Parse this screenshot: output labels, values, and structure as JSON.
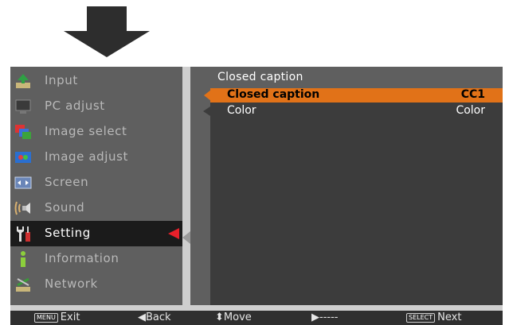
{
  "menu": {
    "items": [
      {
        "label": "Input",
        "icon": "input-icon"
      },
      {
        "label": "PC adjust",
        "icon": "pc-adjust-icon"
      },
      {
        "label": "Image select",
        "icon": "image-select-icon"
      },
      {
        "label": "Image adjust",
        "icon": "image-adjust-icon"
      },
      {
        "label": "Screen",
        "icon": "screen-icon"
      },
      {
        "label": "Sound",
        "icon": "sound-icon"
      },
      {
        "label": "Setting",
        "icon": "setting-icon",
        "selected": true
      },
      {
        "label": "Information",
        "icon": "information-icon"
      },
      {
        "label": "Network",
        "icon": "network-icon"
      }
    ]
  },
  "submenu": {
    "title": "Closed caption",
    "rows": [
      {
        "label": "Closed caption",
        "value": "CC1",
        "active": true
      },
      {
        "label": "Color",
        "value": "Color",
        "active": false
      }
    ]
  },
  "guide": {
    "exit_key": "MENU",
    "exit": "Exit",
    "back": "◀Back",
    "move": "⬍Move",
    "right": "▶-----",
    "select_key": "SELECT",
    "next": "Next"
  },
  "colors": {
    "highlight": "#e17218",
    "pointer": "#e8202a",
    "panel": "#5f5f5f",
    "panel_dark": "#3c3c3c"
  }
}
